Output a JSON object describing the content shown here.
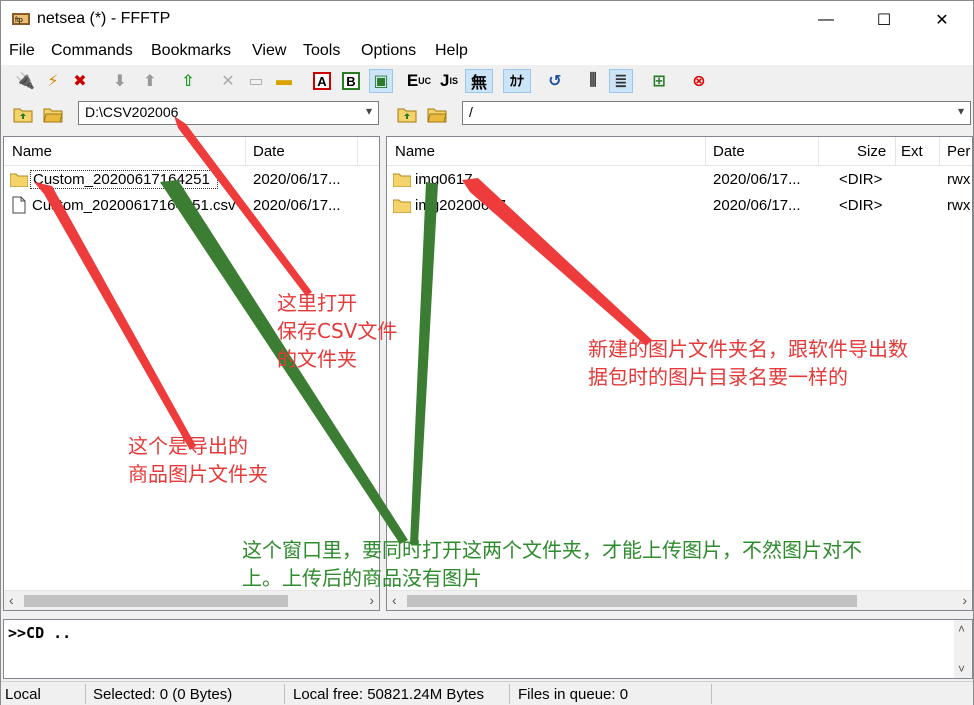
{
  "window": {
    "title": "netsea (*) - FFFTP",
    "minimize": "—",
    "maximize": "☐",
    "close": "✕"
  },
  "menu": [
    "File",
    "Commands",
    "Bookmarks",
    "View",
    "Tools",
    "Options",
    "Help"
  ],
  "toolbar": {
    "e_label": "E",
    "e_sub": "UC",
    "j_label": "J",
    "j_sub": "IS",
    "wu": "無",
    "kana": "ｶﾅ",
    "a_label": "A",
    "b_label": "B"
  },
  "local": {
    "path": "D:\\CSV202006",
    "columns": [
      "Name",
      "Date"
    ],
    "rows": [
      {
        "type": "folder",
        "name": "Custom_20200617164251",
        "date": "2020/06/17..."
      },
      {
        "type": "file",
        "name": "Custom_20200617164251.csv",
        "date": "2020/06/17..."
      }
    ]
  },
  "remote": {
    "path": "/",
    "columns": [
      "Name",
      "Date",
      "Size",
      "Ext",
      "Per"
    ],
    "rows": [
      {
        "type": "folder",
        "name": "img0617",
        "date": "2020/06/17...",
        "size": "<DIR>",
        "perm": "rwx"
      },
      {
        "type": "folder",
        "name": "img20200617",
        "date": "2020/06/17...",
        "size": "<DIR>",
        "perm": "rwx"
      }
    ]
  },
  "log": {
    "text": ">>CD .."
  },
  "status": {
    "mode": "Local",
    "selected": "Selected: 0 (0 Bytes)",
    "free": "Local free: 50821.24M Bytes",
    "queue": "Files in queue: 0"
  },
  "annotations": {
    "open_csv_folder": "这里打开\n保存CSV文件\n的文件夹",
    "image_folder": "这个是导出的\n商品图片文件夹",
    "new_folder_name": "新建的图片文件夹名，跟软件导出数\n据包时的图片目录名要一样的",
    "both_open": "这个窗口里，要同时打开这两个文件夹，才能上传图片，不然图片对不\n上。上传后的商品没有图片"
  },
  "colors": {
    "annotation_red": "#e53a3a",
    "annotation_green": "#2e8b2e",
    "arrow_green": "#3b7d33"
  }
}
